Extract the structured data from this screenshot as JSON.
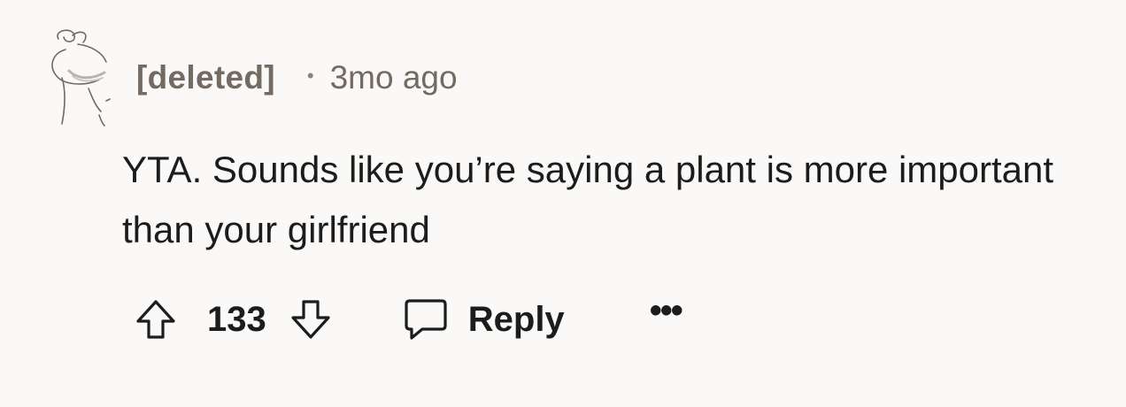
{
  "comment": {
    "username": "[deleted]",
    "separator": "•",
    "timestamp": "3mo ago",
    "body": "YTA. Sounds like you’re saying a plant is more important than your girlfriend",
    "avatar_icon": "deleted-user-avatar-icon"
  },
  "actions": {
    "upvote_icon": "arrow-up-icon",
    "score": "133",
    "downvote_icon": "arrow-down-icon",
    "reply_icon": "speech-bubble-icon",
    "reply_label": "Reply",
    "more_label": "•••"
  },
  "colors": {
    "background": "#faf9f7",
    "meta_text": "#736a62",
    "body_text": "#1c1c1c"
  }
}
